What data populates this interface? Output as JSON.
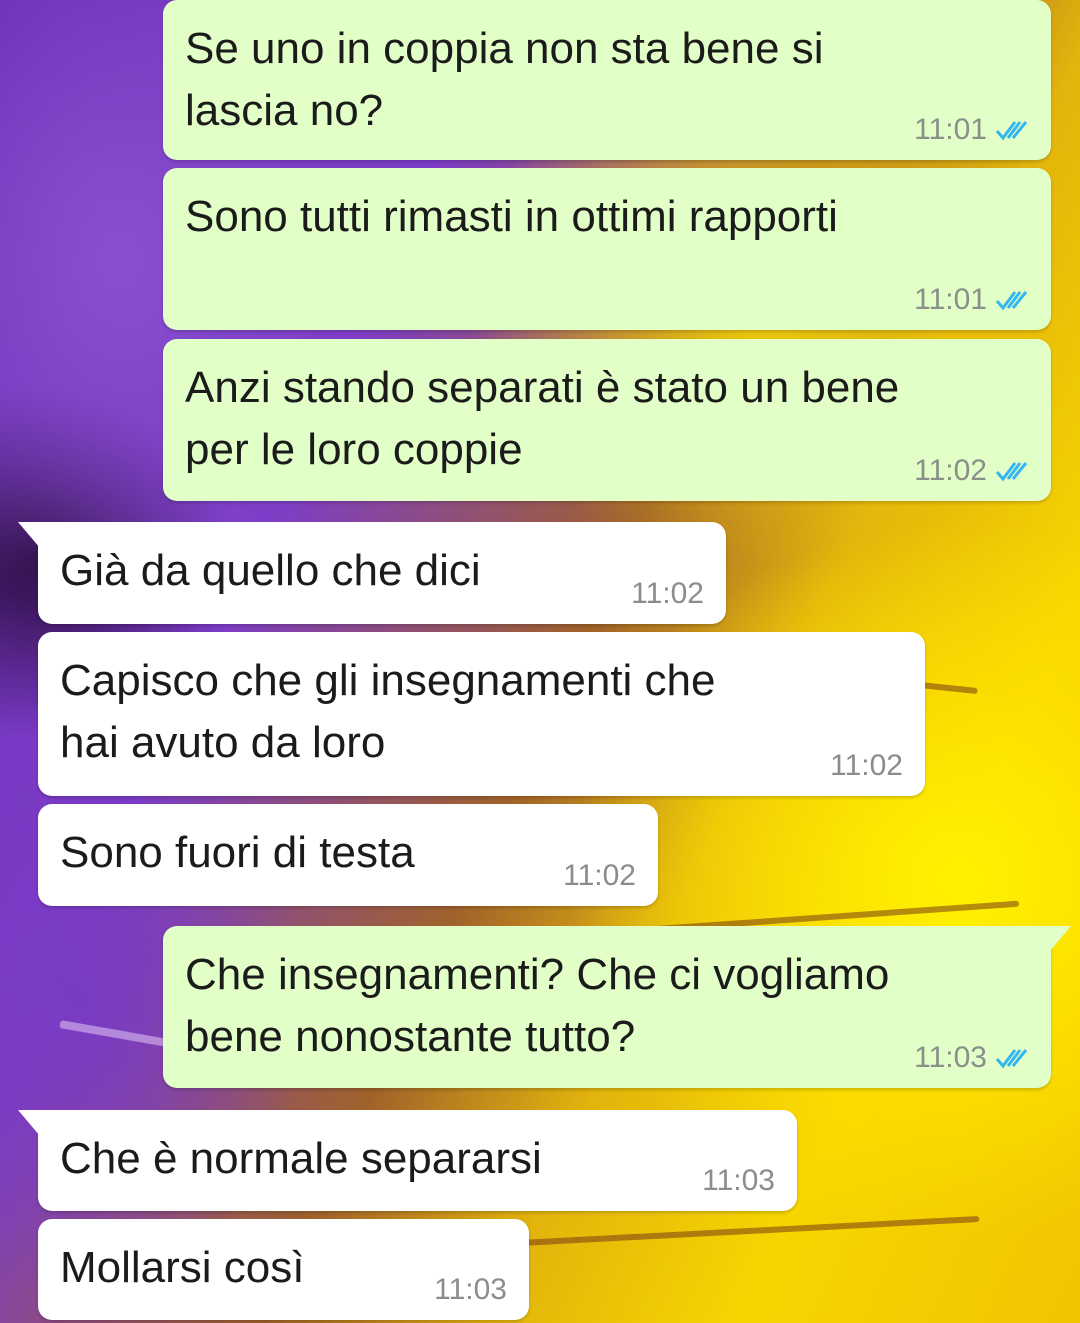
{
  "colors": {
    "outgoing_bubble": "#e1ffc7",
    "incoming_bubble": "#ffffff",
    "read_ticks": "#34b7f1",
    "timestamp": "#8a8f8a"
  },
  "icons": {
    "read_receipt": "double-check-icon"
  },
  "messages": [
    {
      "direction": "outgoing",
      "text": "Se uno in coppia non sta bene si\nlascia no?",
      "time": "11:01",
      "status": "read"
    },
    {
      "direction": "outgoing",
      "text": "Sono tutti rimasti in ottimi rapporti",
      "time": "11:01",
      "status": "read"
    },
    {
      "direction": "outgoing",
      "text": "Anzi stando separati è stato un bene\nper le loro coppie",
      "time": "11:02",
      "status": "read"
    },
    {
      "direction": "incoming",
      "text": "Già da quello che dici",
      "time": "11:02"
    },
    {
      "direction": "incoming",
      "text": "Capisco che gli insegnamenti che\nhai avuto da loro",
      "time": "11:02"
    },
    {
      "direction": "incoming",
      "text": "Sono fuori di testa",
      "time": "11:02"
    },
    {
      "direction": "outgoing",
      "text": "Che insegnamenti? Che ci vogliamo\nbene nonostante tutto?",
      "time": "11:03",
      "status": "read"
    },
    {
      "direction": "incoming",
      "text": "Che è normale separarsi",
      "time": "11:03"
    },
    {
      "direction": "incoming",
      "text": "Mollarsi così",
      "time": "11:03"
    }
  ]
}
